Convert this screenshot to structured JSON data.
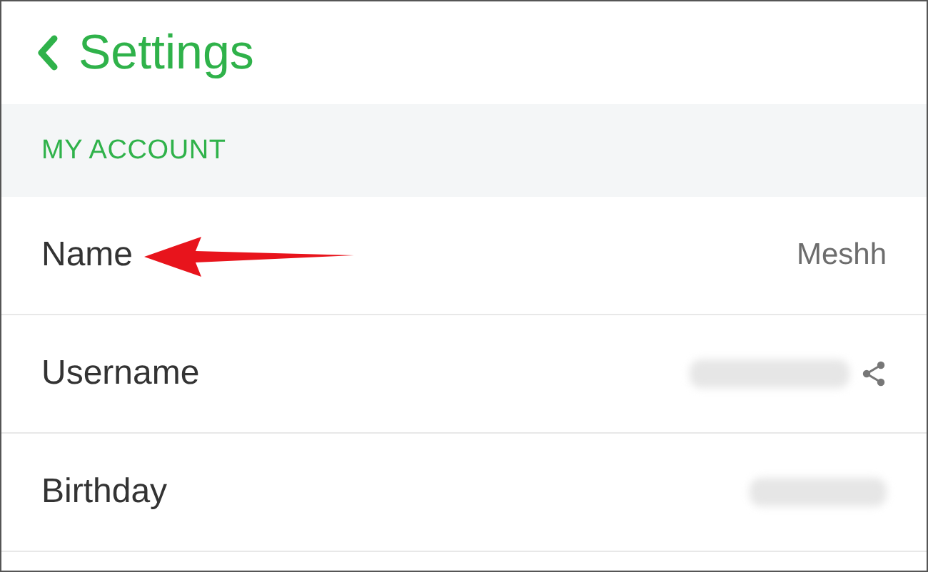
{
  "header": {
    "title": "Settings"
  },
  "section": {
    "title": "MY ACCOUNT"
  },
  "rows": [
    {
      "label": "Name",
      "kind": "text",
      "value": "Meshh",
      "share": false,
      "pointed": true
    },
    {
      "label": "Username",
      "kind": "redacted",
      "share": true,
      "pointed": false
    },
    {
      "label": "Birthday",
      "kind": "redacted",
      "share": false,
      "pointed": false
    }
  ]
}
